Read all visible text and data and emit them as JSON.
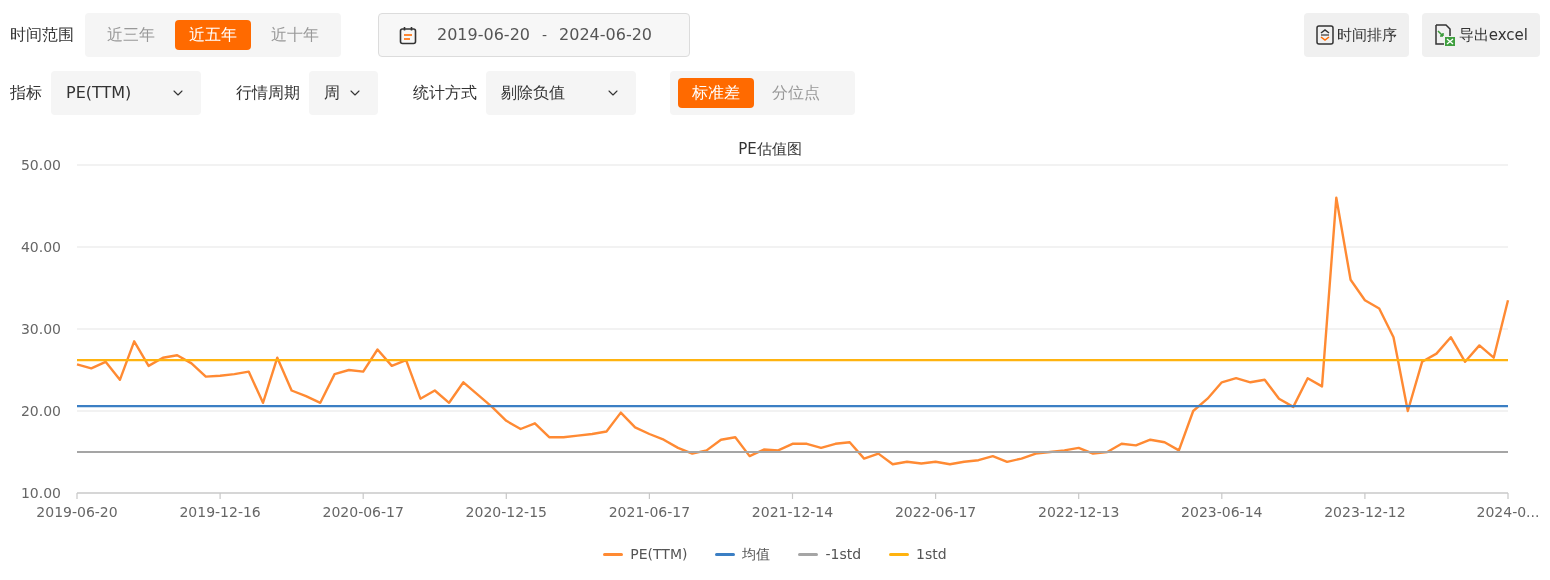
{
  "filters": {
    "time_range": {
      "label": "时间范围",
      "options": [
        {
          "label": "近三年",
          "selected": false
        },
        {
          "label": "近五年",
          "selected": true
        },
        {
          "label": "近十年",
          "selected": false
        }
      ]
    },
    "date_range": {
      "start": "2019-06-20",
      "separator": "-",
      "end": "2024-06-20"
    },
    "actions": [
      {
        "kind": "sort",
        "label": "时间排序"
      },
      {
        "kind": "export",
        "label": "导出excel"
      }
    ],
    "selectors": [
      {
        "label": "指标",
        "value": "PE(TTM)"
      },
      {
        "label": "行情周期",
        "value": "周"
      },
      {
        "label": "统计方式",
        "value": "剔除负值"
      }
    ],
    "method_toggle": [
      {
        "label": "标准差",
        "selected": true
      },
      {
        "label": "分位点",
        "selected": false
      }
    ]
  },
  "chart": {
    "chart_data": {
      "type": "line",
      "title": "PE估值图",
      "categories": [
        "2019-06-20",
        null,
        null,
        null,
        null,
        null,
        null,
        null,
        null,
        null,
        "2019-12-16",
        null,
        null,
        null,
        null,
        null,
        null,
        null,
        null,
        null,
        "2020-06-17",
        null,
        null,
        null,
        null,
        null,
        null,
        null,
        null,
        null,
        "2020-12-15",
        null,
        null,
        null,
        null,
        null,
        null,
        null,
        null,
        null,
        "2021-06-17",
        null,
        null,
        null,
        null,
        null,
        null,
        null,
        null,
        null,
        "2021-12-14",
        null,
        null,
        null,
        null,
        null,
        null,
        null,
        null,
        null,
        "2022-06-17",
        null,
        null,
        null,
        null,
        null,
        null,
        null,
        null,
        null,
        "2022-12-13",
        null,
        null,
        null,
        null,
        null,
        null,
        null,
        null,
        null,
        "2023-06-14",
        null,
        null,
        null,
        null,
        null,
        null,
        null,
        null,
        null,
        "2023-12-12",
        null,
        null,
        null,
        null,
        null,
        null,
        null,
        null,
        null,
        "2024-0..."
      ],
      "ylim": [
        10,
        50
      ],
      "grid": true,
      "legend": true,
      "yticks": [
        {
          "value": 10,
          "label": "10.00"
        },
        {
          "value": 20,
          "label": "20.00"
        },
        {
          "value": 30,
          "label": "30.00"
        },
        {
          "value": 40,
          "label": "40.00"
        },
        {
          "value": 50,
          "label": "50.00"
        }
      ],
      "series": [
        {
          "name": "PE(TTM)",
          "color": "#ff8a33",
          "values": [
            25.7,
            25.2,
            26.0,
            23.8,
            28.5,
            25.5,
            26.5,
            26.8,
            25.8,
            24.2,
            24.3,
            24.5,
            24.8,
            21.0,
            26.5,
            22.5,
            21.8,
            21.0,
            24.5,
            25.0,
            24.8,
            27.5,
            25.5,
            26.2,
            21.5,
            22.5,
            21.0,
            23.5,
            22.0,
            20.5,
            18.8,
            17.8,
            18.5,
            16.8,
            16.8,
            17.0,
            17.2,
            17.5,
            19.8,
            18.0,
            17.2,
            16.5,
            15.5,
            14.8,
            15.2,
            16.5,
            16.8,
            14.5,
            15.3,
            15.2,
            16.0,
            16.0,
            15.5,
            16.0,
            16.2,
            14.2,
            14.8,
            13.5,
            13.8,
            13.6,
            13.8,
            13.5,
            13.8,
            14.0,
            14.5,
            13.8,
            14.2,
            14.8,
            15.0,
            15.2,
            15.5,
            14.8,
            15.0,
            16.0,
            15.8,
            16.5,
            16.2,
            15.2,
            20.0,
            21.5,
            23.5,
            24.0,
            23.5,
            23.8,
            21.5,
            20.5,
            24.0,
            23.0,
            46.0,
            36.0,
            33.5,
            32.5,
            29.0,
            20.0,
            26.0,
            27.0,
            29.0,
            26.0,
            28.0,
            26.5,
            33.5
          ]
        },
        {
          "name": "均值",
          "color": "#3b7fc4",
          "values": [
            20.6,
            20.6,
            20.6,
            20.6,
            20.6,
            20.6,
            20.6,
            20.6,
            20.6,
            20.6,
            20.6,
            20.6,
            20.6,
            20.6,
            20.6,
            20.6,
            20.6,
            20.6,
            20.6,
            20.6,
            20.6,
            20.6,
            20.6,
            20.6,
            20.6,
            20.6,
            20.6,
            20.6,
            20.6,
            20.6,
            20.6,
            20.6,
            20.6,
            20.6,
            20.6,
            20.6,
            20.6,
            20.6,
            20.6,
            20.6,
            20.6,
            20.6,
            20.6,
            20.6,
            20.6,
            20.6,
            20.6,
            20.6,
            20.6,
            20.6,
            20.6,
            20.6,
            20.6,
            20.6,
            20.6,
            20.6,
            20.6,
            20.6,
            20.6,
            20.6,
            20.6,
            20.6,
            20.6,
            20.6,
            20.6,
            20.6,
            20.6,
            20.6,
            20.6,
            20.6,
            20.6,
            20.6,
            20.6,
            20.6,
            20.6,
            20.6,
            20.6,
            20.6,
            20.6,
            20.6,
            20.6,
            20.6,
            20.6,
            20.6,
            20.6,
            20.6,
            20.6,
            20.6,
            20.6,
            20.6,
            20.6,
            20.6,
            20.6,
            20.6,
            20.6,
            20.6,
            20.6,
            20.6,
            20.6,
            20.6,
            20.6
          ]
        },
        {
          "name": "-1std",
          "color": "#a5a5a5",
          "values": [
            15.0,
            15.0,
            15.0,
            15.0,
            15.0,
            15.0,
            15.0,
            15.0,
            15.0,
            15.0,
            15.0,
            15.0,
            15.0,
            15.0,
            15.0,
            15.0,
            15.0,
            15.0,
            15.0,
            15.0,
            15.0,
            15.0,
            15.0,
            15.0,
            15.0,
            15.0,
            15.0,
            15.0,
            15.0,
            15.0,
            15.0,
            15.0,
            15.0,
            15.0,
            15.0,
            15.0,
            15.0,
            15.0,
            15.0,
            15.0,
            15.0,
            15.0,
            15.0,
            15.0,
            15.0,
            15.0,
            15.0,
            15.0,
            15.0,
            15.0,
            15.0,
            15.0,
            15.0,
            15.0,
            15.0,
            15.0,
            15.0,
            15.0,
            15.0,
            15.0,
            15.0,
            15.0,
            15.0,
            15.0,
            15.0,
            15.0,
            15.0,
            15.0,
            15.0,
            15.0,
            15.0,
            15.0,
            15.0,
            15.0,
            15.0,
            15.0,
            15.0,
            15.0,
            15.0,
            15.0,
            15.0,
            15.0,
            15.0,
            15.0,
            15.0,
            15.0,
            15.0,
            15.0,
            15.0,
            15.0,
            15.0,
            15.0,
            15.0,
            15.0,
            15.0,
            15.0,
            15.0,
            15.0,
            15.0,
            15.0,
            15.0
          ]
        },
        {
          "name": "1std",
          "color": "#ffb30f",
          "values": [
            26.2,
            26.2,
            26.2,
            26.2,
            26.2,
            26.2,
            26.2,
            26.2,
            26.2,
            26.2,
            26.2,
            26.2,
            26.2,
            26.2,
            26.2,
            26.2,
            26.2,
            26.2,
            26.2,
            26.2,
            26.2,
            26.2,
            26.2,
            26.2,
            26.2,
            26.2,
            26.2,
            26.2,
            26.2,
            26.2,
            26.2,
            26.2,
            26.2,
            26.2,
            26.2,
            26.2,
            26.2,
            26.2,
            26.2,
            26.2,
            26.2,
            26.2,
            26.2,
            26.2,
            26.2,
            26.2,
            26.2,
            26.2,
            26.2,
            26.2,
            26.2,
            26.2,
            26.2,
            26.2,
            26.2,
            26.2,
            26.2,
            26.2,
            26.2,
            26.2,
            26.2,
            26.2,
            26.2,
            26.2,
            26.2,
            26.2,
            26.2,
            26.2,
            26.2,
            26.2,
            26.2,
            26.2,
            26.2,
            26.2,
            26.2,
            26.2,
            26.2,
            26.2,
            26.2,
            26.2,
            26.2,
            26.2,
            26.2,
            26.2,
            26.2,
            26.2,
            26.2,
            26.2,
            26.2,
            26.2,
            26.2,
            26.2,
            26.2,
            26.2,
            26.2,
            26.2,
            26.2,
            26.2,
            26.2,
            26.2,
            26.2
          ]
        }
      ]
    }
  }
}
